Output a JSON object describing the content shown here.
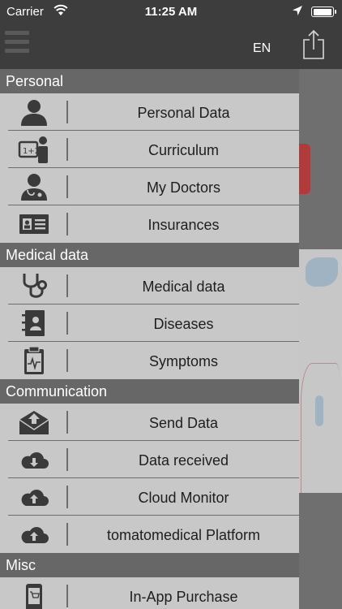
{
  "status_bar": {
    "carrier": "Carrier",
    "time": "11:25 AM"
  },
  "header": {
    "language": "EN"
  },
  "menu": {
    "sections": [
      {
        "title": "Personal",
        "items": [
          {
            "label": "Personal Data",
            "icon": "person-icon"
          },
          {
            "label": "Curriculum",
            "icon": "curriculum-icon"
          },
          {
            "label": "My Doctors",
            "icon": "doctor-icon"
          },
          {
            "label": "Insurances",
            "icon": "id-card-icon"
          }
        ]
      },
      {
        "title": "Medical data",
        "items": [
          {
            "label": "Medical data",
            "icon": "stethoscope-icon"
          },
          {
            "label": "Diseases",
            "icon": "contacts-book-icon"
          },
          {
            "label": "Symptoms",
            "icon": "clipboard-pulse-icon"
          }
        ]
      },
      {
        "title": "Communication",
        "items": [
          {
            "label": "Send Data",
            "icon": "inbox-upload-icon"
          },
          {
            "label": "Data received",
            "icon": "cloud-download-icon"
          },
          {
            "label": "Cloud Monitor",
            "icon": "cloud-upload-icon"
          },
          {
            "label": "tomatomedical Platform",
            "icon": "cloud-upload-icon"
          }
        ]
      },
      {
        "title": "Misc",
        "items": [
          {
            "label": "In-App Purchase",
            "icon": "shopping-icon"
          }
        ]
      }
    ]
  }
}
